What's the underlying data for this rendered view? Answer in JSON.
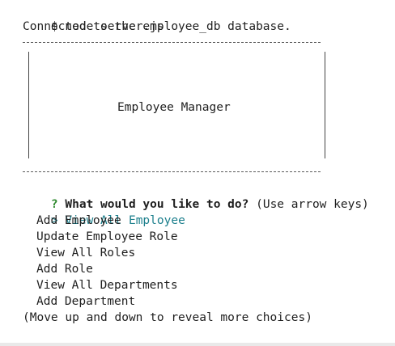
{
  "terminal": {
    "command_prompt": "$",
    "command_text": "node server.js",
    "connection_message": "Connected to the employee_db database.",
    "banner_title": "Employee Manager",
    "question_mark": "?",
    "question_text": "What would you like to do?",
    "question_hint": "(Use arrow keys)",
    "pointer": ">",
    "menu_items": [
      "View All Employee",
      "Add Employee",
      "Update Employee Role",
      "View All Roles",
      "Add Role",
      "View All Departments",
      "Add Department"
    ],
    "footer_hint": "(Move up and down to reveal more choices)"
  },
  "colors": {
    "selected_item": "#1c7f8c",
    "question_mark": "#2f8a2f",
    "text": "#1f1f1f",
    "background": "#ffffff"
  }
}
